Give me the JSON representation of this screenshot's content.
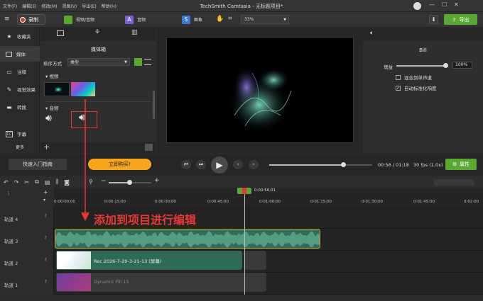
{
  "menu": [
    "文件(F)",
    "编辑(E)",
    "修改(M)",
    "视图(V)",
    "导出(E)",
    "帮助(H)"
  ],
  "app_title": "TechSmith Camtasia - 无标题项目*",
  "toolbar": {
    "record_label": "录制",
    "tools": [
      "视频/音频",
      "音频",
      "图象"
    ],
    "zoom": "33%",
    "export_label": "导出"
  },
  "leftnav": [
    "收藏夹",
    "媒体",
    "注释",
    "视觉效果",
    "转换",
    "字幕",
    "更多"
  ],
  "mediabin": {
    "title": "媒体箱",
    "sort_label": "排序方式",
    "sort_value": "类型",
    "section_video": "视频",
    "section_audio": "音频"
  },
  "props": {
    "title": "Bill",
    "gain_label": "增益",
    "gain_value": "100%",
    "gain_fraction": 1.0,
    "mix_label": "混合到单声道",
    "mix_checked": false,
    "normalize_label": "自动标准化响度",
    "normalize_checked": true
  },
  "playback": {
    "guide_button": "快速入门指南",
    "buy_button": "立即购买!",
    "time": "00:56 / 01:18",
    "fps": "30 fps (1.0x)",
    "props_button": "属性",
    "progress_fraction": 0.72
  },
  "ruler": {
    "playhead_time": "0:00:56;01",
    "ticks": [
      "0:00:00;00",
      "0:00:15;00",
      "0:00:30;00",
      "0:00:45;00",
      "0:01:00;00",
      "0:01:15;00",
      "0:01:30;00",
      "0:01:45;00",
      "0:02:00"
    ]
  },
  "tracks": [
    {
      "label": "轨道 4"
    },
    {
      "label": "轨道 3"
    },
    {
      "label": "轨道 2",
      "clip": "Rec 2026-7-20-3-21-13 (屏幕)"
    },
    {
      "label": "轨道 1",
      "clip": "Dynamic Fill 15"
    }
  ],
  "annotation": "添加到项目进行编辑",
  "colors": {
    "accent_green": "#5aa832",
    "buy_orange": "#f7a51e",
    "annotation_red": "#e53935",
    "audio_clip": "#3c8a6a"
  }
}
